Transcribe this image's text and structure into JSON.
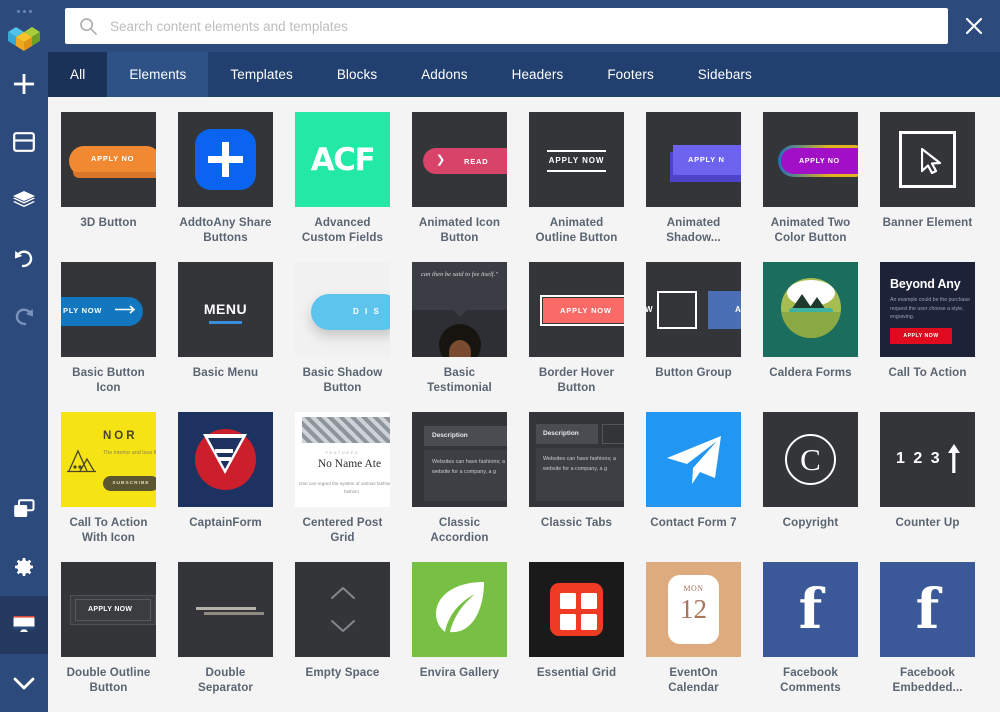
{
  "window": {
    "dots_count": 3,
    "logo_name": "visual-composer-logo"
  },
  "search": {
    "placeholder": "Search content elements and templates",
    "value": "",
    "icon": "search-icon"
  },
  "close_label": "×",
  "sidebar": {
    "items": [
      {
        "name": "add",
        "icon": "plus-icon",
        "active": false,
        "dim": false
      },
      {
        "name": "templates",
        "icon": "window-icon",
        "active": false,
        "dim": false
      },
      {
        "name": "layers",
        "icon": "layers-icon",
        "active": false,
        "dim": false
      },
      {
        "name": "undo",
        "icon": "undo-icon",
        "active": false,
        "dim": false
      },
      {
        "name": "redo",
        "icon": "redo-icon",
        "active": false,
        "dim": true
      },
      {
        "name": "clipboard",
        "icon": "copy-icon",
        "active": false,
        "dim": false
      },
      {
        "name": "settings",
        "icon": "gear-icon",
        "active": false,
        "dim": false
      },
      {
        "name": "insights",
        "icon": "panel-icon",
        "active": true,
        "dim": false
      },
      {
        "name": "publish",
        "icon": "check-icon",
        "active": false,
        "dim": false
      }
    ]
  },
  "tabs": [
    {
      "label": "All",
      "state": "dark"
    },
    {
      "label": "Elements",
      "state": "active"
    },
    {
      "label": "Templates",
      "state": "normal"
    },
    {
      "label": "Blocks",
      "state": "normal"
    },
    {
      "label": "Addons",
      "state": "normal"
    },
    {
      "label": "Headers",
      "state": "normal"
    },
    {
      "label": "Footers",
      "state": "normal"
    },
    {
      "label": "Sidebars",
      "state": "normal"
    }
  ],
  "colors": {
    "sidebar_bg": "#2c4a7c",
    "topbar_bg": "#2c4a7c",
    "tabbar_bg": "#22406f",
    "tab_active_bg": "#2e5186",
    "tab_dark_bg": "#1b3258",
    "grid_bg": "#f4f4f4",
    "thumb_default_bg": "#333538",
    "label_color": "#5a6472"
  },
  "grid": {
    "columns": 8,
    "items": [
      {
        "label": "3D Button",
        "art": "t-3d",
        "art_text": {
          "button": "APPLY NO"
        }
      },
      {
        "label": "AddtoAny Share Buttons",
        "art": "t-ata",
        "art_text": {}
      },
      {
        "label": "Advanced Custom Fields",
        "art": "t-acf",
        "art_text": {
          "wordmark": "ACF"
        }
      },
      {
        "label": "Animated Icon Button",
        "art": "t-aib",
        "art_text": {
          "button": "READ"
        }
      },
      {
        "label": "Animated Outline Button",
        "art": "t-aob",
        "art_text": {
          "button": "APPLY NOW"
        }
      },
      {
        "label": "Animated Shadow...",
        "art": "t-ash",
        "art_text": {
          "button": "APPLY N"
        }
      },
      {
        "label": "Animated Two Color Button",
        "art": "t-atc",
        "art_text": {
          "button": "APPLY NO"
        }
      },
      {
        "label": "Banner Element",
        "art": "t-ban",
        "art_text": {}
      },
      {
        "label": "Basic Button Icon",
        "art": "t-bbi",
        "art_text": {
          "button": "PLY NOW"
        }
      },
      {
        "label": "Basic Menu",
        "art": "t-bmn",
        "art_text": {
          "menu": "MENU"
        }
      },
      {
        "label": "Basic Shadow Button",
        "art": "t-bsb",
        "art_text": {
          "button": "D I S"
        }
      },
      {
        "label": "Basic Testimonial",
        "art": "t-bts",
        "art_text": {
          "quote": "can then be said to fee itself.\""
        }
      },
      {
        "label": "Border Hover Button",
        "art": "t-bhb",
        "art_text": {
          "button": "APPLY NOW"
        }
      },
      {
        "label": "Button Group",
        "art": "t-bgp",
        "art_text": {
          "left": "W",
          "right": "A"
        }
      },
      {
        "label": "Caldera Forms",
        "art": "t-cal",
        "art_text": {}
      },
      {
        "label": "Call To Action",
        "art": "t-cta",
        "art_text": {
          "heading": "Beyond Any",
          "body": "An example could be the purchase request the user choose a style, engraving.",
          "button": "APPLY NOW"
        }
      },
      {
        "label": "Call To Action With Icon",
        "art": "t-ctai",
        "art_text": {
          "heading": "NOR",
          "body": "The interior and lava field",
          "button": "SUBSCRIBE"
        }
      },
      {
        "label": "CaptainForm",
        "art": "t-cpf",
        "art_text": {}
      },
      {
        "label": "Centered Post Grid",
        "art": "t-cpg",
        "art_text": {
          "eyebrow": "FEATURED",
          "title": "No Name Ate",
          "body": "One can regard the system of various fashions as a fashion"
        }
      },
      {
        "label": "Classic Accordion",
        "art": "t-acc",
        "art_text": {
          "header": "Description",
          "body": "Websites can have fashions; a website for a company, a g"
        }
      },
      {
        "label": "Classic Tabs",
        "art": "t-tab",
        "art_text": {
          "header": "Description",
          "body": "Websites can have fashions; a website for a company, a g"
        }
      },
      {
        "label": "Contact Form 7",
        "art": "t-cf7",
        "art_text": {}
      },
      {
        "label": "Copyright",
        "art": "t-cpy",
        "art_text": {
          "symbol": "C"
        }
      },
      {
        "label": "Counter Up",
        "art": "t-cnt",
        "art_text": {
          "number": "1 2 3"
        }
      },
      {
        "label": "Double Outline Button",
        "art": "t-dob",
        "art_text": {
          "button": "APPLY NOW"
        }
      },
      {
        "label": "Double Separator",
        "art": "t-dsp",
        "art_text": {}
      },
      {
        "label": "Empty Space",
        "art": "t-esp",
        "art_text": {}
      },
      {
        "label": "Envira Gallery",
        "art": "t-env",
        "art_text": {}
      },
      {
        "label": "Essential Grid",
        "art": "t-egr",
        "art_text": {}
      },
      {
        "label": "EventOn Calendar",
        "art": "t-evt",
        "art_text": {
          "month": "MON",
          "day": "12"
        }
      },
      {
        "label": "Facebook Comments",
        "art": "t-fb",
        "art_text": {
          "f": "f"
        }
      },
      {
        "label": "Facebook Embedded...",
        "art": "t-fb",
        "art_text": {
          "f": "f"
        }
      }
    ]
  }
}
